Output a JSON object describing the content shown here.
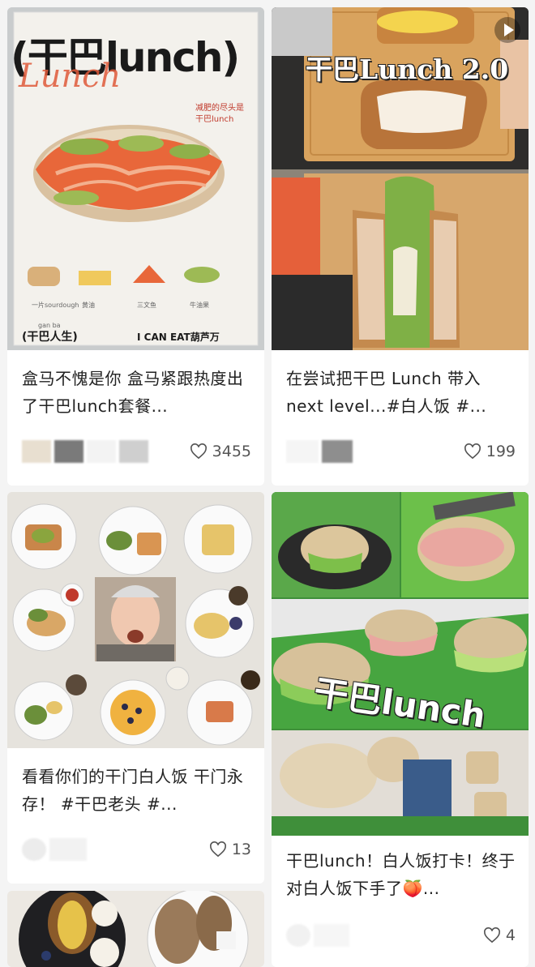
{
  "cards": [
    {
      "title": "盒马不愧是你 盒马紧跟热度出了干巴lunch套餐...",
      "likes": "3455",
      "overlay_top": "(干巴lunch)",
      "overlay_script": "Lunch",
      "poster_footer_left": "(干巴人生)",
      "poster_footer_right": "I CAN EAT葫芦万",
      "poster_note": "减肥的尽头是干巴lunch",
      "poster_pinyin": "gan ba"
    },
    {
      "title": "在尝试把干巴 Lunch 带入 next level...#白人饭 #...",
      "likes": "199",
      "overlay": "干巴Lunch 2.0"
    },
    {
      "title": "看看你们的干门白人饭 干门永存！ #干巴老头 #...",
      "likes": "13"
    },
    {
      "title": "干巴lunch！白人饭打卡！终于对白人饭下手了🍑...",
      "likes": "4",
      "overlay": "干巴lunch"
    }
  ],
  "colors": {
    "background": "#f4f4f4",
    "card": "#ffffff",
    "like_icon": "#555555"
  },
  "icons": {
    "like": "heart-outline-icon",
    "play": "play-icon"
  }
}
